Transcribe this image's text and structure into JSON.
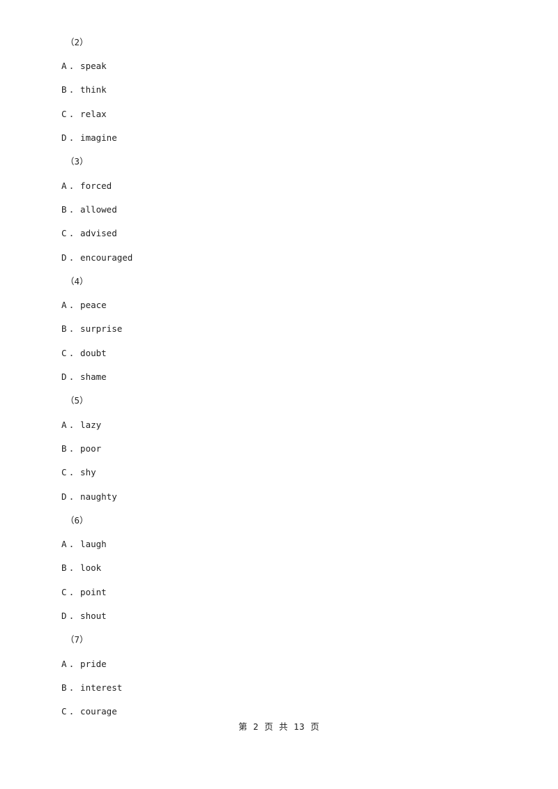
{
  "document": {
    "blocks": [
      {
        "number": "（2）",
        "options": [
          {
            "letter": "A",
            "sep": "．",
            "text": "speak"
          },
          {
            "letter": "B",
            "sep": "．",
            "text": "think"
          },
          {
            "letter": "C",
            "sep": "．",
            "text": "relax"
          },
          {
            "letter": "D",
            "sep": "．",
            "text": "imagine"
          }
        ]
      },
      {
        "number": "（3）",
        "options": [
          {
            "letter": "A",
            "sep": "．",
            "text": "forced"
          },
          {
            "letter": "B",
            "sep": "．",
            "text": "allowed"
          },
          {
            "letter": "C",
            "sep": "．",
            "text": "advised"
          },
          {
            "letter": "D",
            "sep": "．",
            "text": "encouraged"
          }
        ]
      },
      {
        "number": "（4）",
        "options": [
          {
            "letter": "A",
            "sep": "．",
            "text": "peace"
          },
          {
            "letter": "B",
            "sep": "．",
            "text": "surprise"
          },
          {
            "letter": "C",
            "sep": "．",
            "text": "doubt"
          },
          {
            "letter": "D",
            "sep": "．",
            "text": "shame"
          }
        ]
      },
      {
        "number": "（5）",
        "options": [
          {
            "letter": "A",
            "sep": "．",
            "text": "lazy"
          },
          {
            "letter": "B",
            "sep": "．",
            "text": "poor"
          },
          {
            "letter": "C",
            "sep": "．",
            "text": "shy"
          },
          {
            "letter": "D",
            "sep": "．",
            "text": "naughty"
          }
        ]
      },
      {
        "number": "（6）",
        "options": [
          {
            "letter": "A",
            "sep": "．",
            "text": "laugh"
          },
          {
            "letter": "B",
            "sep": "．",
            "text": "look"
          },
          {
            "letter": "C",
            "sep": "．",
            "text": "point"
          },
          {
            "letter": "D",
            "sep": "．",
            "text": "shout"
          }
        ]
      },
      {
        "number": "（7）",
        "options": [
          {
            "letter": "A",
            "sep": "．",
            "text": "pride"
          },
          {
            "letter": "B",
            "sep": "．",
            "text": "interest"
          },
          {
            "letter": "C",
            "sep": "．",
            "text": "courage"
          }
        ]
      }
    ],
    "footer": "第 2 页 共 13 页"
  }
}
